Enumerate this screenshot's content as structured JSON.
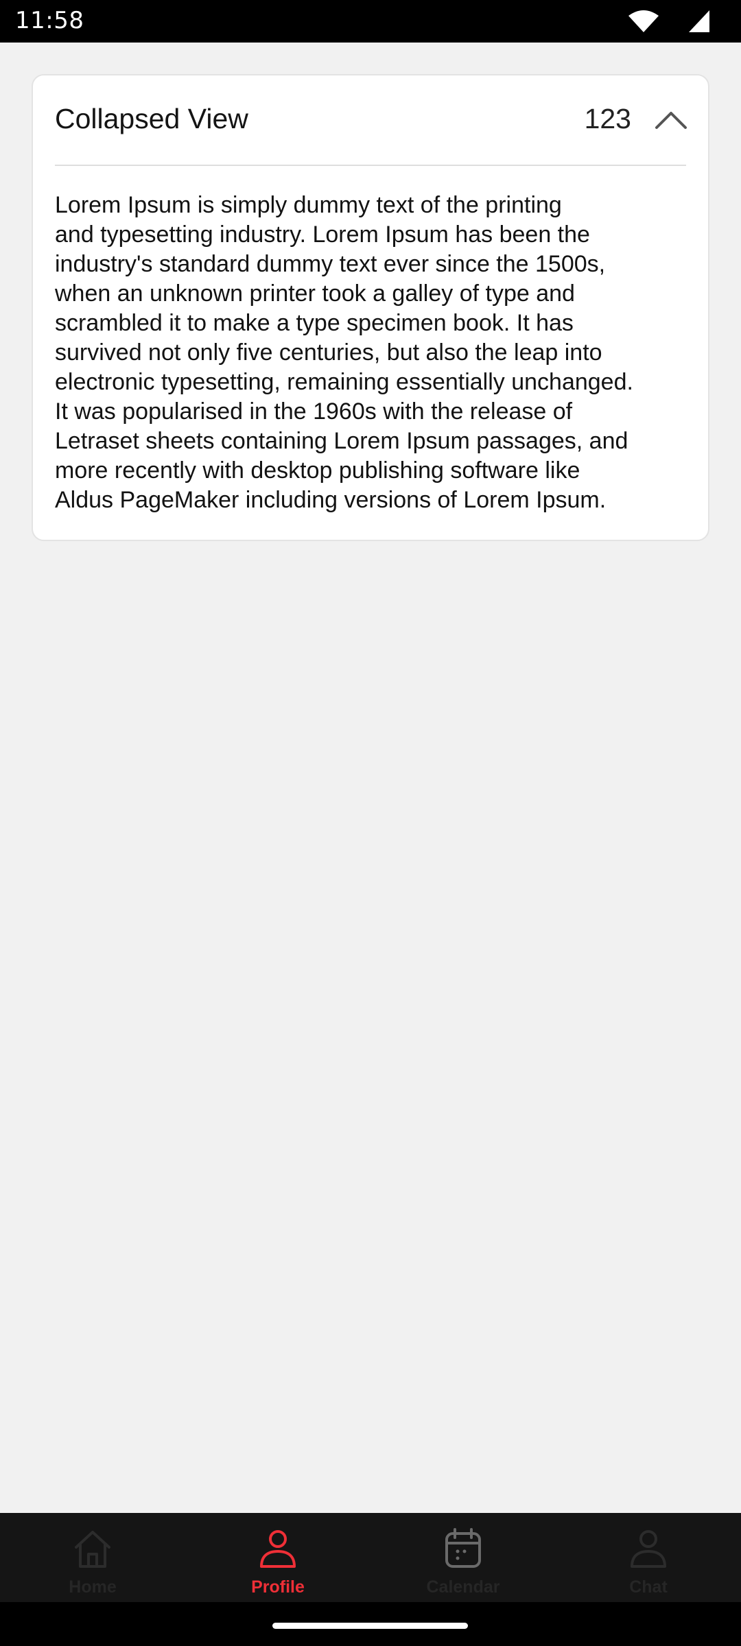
{
  "status_bar": {
    "time": "11:58",
    "icons": [
      "wifi-icon",
      "cellular-signal-icon"
    ]
  },
  "card": {
    "title": "Collapsed View",
    "count": "123",
    "toggle_icon": "chevron-up-icon",
    "body": "Lorem Ipsum is simply dummy text of the printing\nand typesetting industry. Lorem Ipsum has been the\nindustry's standard dummy text ever since the 1500s,\nwhen an unknown printer took a galley of type and\nscrambled it to make a type specimen book. It has\nsurvived not only five centuries, but also the leap into\nelectronic typesetting, remaining essentially unchanged.\nIt was popularised in the 1960s with the release of\nLetraset sheets containing Lorem Ipsum passages, and\nmore recently with desktop publishing software like\nAldus PageMaker including versions of Lorem Ipsum."
  },
  "bottom_nav": {
    "items": [
      {
        "label": "Home",
        "icon": "home-icon",
        "active": false
      },
      {
        "label": "Profile",
        "icon": "profile-icon",
        "active": true
      },
      {
        "label": "Calendar",
        "icon": "calendar-icon",
        "active": false
      },
      {
        "label": "Chat",
        "icon": "chat-icon",
        "active": false
      }
    ]
  },
  "colors": {
    "background": "#f1f1f1",
    "card": "#ffffff",
    "accent": "#ef2f37",
    "nav_background": "#151515",
    "inactive_icon": "#2c2c2c"
  }
}
